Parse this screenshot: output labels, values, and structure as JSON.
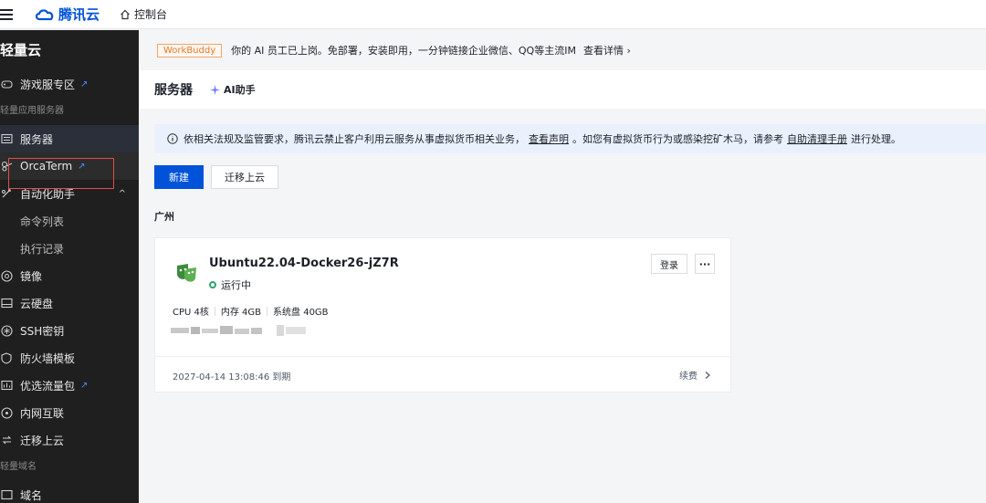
{
  "topbar": {
    "brand": "腾讯云",
    "console": "控制台"
  },
  "sidebar": {
    "title": "轻量云",
    "group_app": "轻量应用服务器",
    "group_domain": "轻量域名",
    "items": {
      "game": "游戏服专区",
      "server": "服务器",
      "orcaterm": "OrcaTerm",
      "automation": "自动化助手",
      "cmd_list": "命令列表",
      "exec_log": "执行记录",
      "image": "镜像",
      "disk": "云硬盘",
      "ssh": "SSH密钥",
      "firewall": "防火墙模板",
      "traffic": "优选流量包",
      "intranet": "内网互联",
      "migrate": "迁移上云",
      "domain": "域名"
    }
  },
  "banner": {
    "tag": "WorkBuddy",
    "text": "你的 AI 员工已上岗。免部署，安装即用，一分钟链接企业微信、QQ等主流IM",
    "more": "查看详情"
  },
  "header": {
    "title": "服务器",
    "ai": "AI助手"
  },
  "notice": {
    "text1": "依相关法规及监管要求，腾讯云禁止客户利用云服务从事虚拟货币相关业务，",
    "link1": "查看声明",
    "text2": "。如您有虚拟货币行为或感染挖矿木马，请参考",
    "link2": "自助清理手册",
    "text3": "进行处理。"
  },
  "actions": {
    "create": "新建",
    "migrate": "迁移上云"
  },
  "region": "广州",
  "card": {
    "name": "Ubuntu22.04-Docker26-jZ7R",
    "status": "运行中",
    "cpu": "CPU 4核",
    "mem": "内存 4GB",
    "disk": "系统盘 40GB",
    "login": "登录",
    "more": "···",
    "expire": "2027-04-14 13:08:46 到期",
    "renew": "续费"
  },
  "colors": {
    "primary": "#0052d9",
    "sidebar_bg": "#1f1f1f",
    "running": "#2ba471",
    "highlight_box": "#e34d4d"
  }
}
